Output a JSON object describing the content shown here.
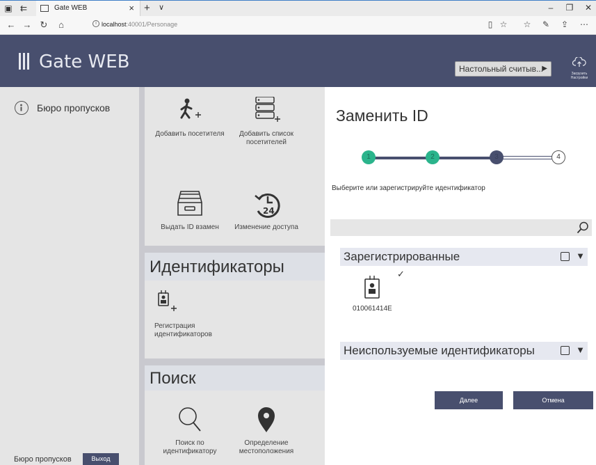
{
  "browser": {
    "tab_title": "Gate WEB",
    "tab_close": "×",
    "new_tab": "+",
    "tab_menu": "∨",
    "url_host": "localhost",
    "url_path": ":40001/Personage",
    "win_minimize": "–",
    "win_maximize": "❐",
    "win_close": "✕"
  },
  "header": {
    "app_title": "Gate WEB",
    "reader_button": "Настольный считыв...",
    "reader_arrow": "▶",
    "cloud_label": "Загрузить Настройки"
  },
  "sidebar": {
    "item_label": "Бюро пропусков",
    "footer_text": "Бюро пропусков",
    "logout_label": "Выход"
  },
  "middle": {
    "tiles_top": [
      {
        "label": "Добавить посетителя"
      },
      {
        "label": "Добавить список посетителей"
      },
      {
        "label": "Выдать ID взамен"
      },
      {
        "label": "Изменение доступа"
      }
    ],
    "section_ids": "Идентификаторы",
    "tile_reg": "Регистрация идентификаторов",
    "section_search": "Поиск",
    "tile_search": "Поиск по идентификатору",
    "tile_location": "Определение местоположения",
    "clock_number": "24"
  },
  "panel": {
    "title": "Заменить ID",
    "steps": [
      "1",
      "2",
      "3",
      "4"
    ],
    "instruction": "Выберите или зарегистрируйте идентификатор",
    "search_value": "",
    "group_registered": "Зарегистрированные",
    "group_unused": "Неиспользуемые идентификаторы",
    "card_id": "010061414E",
    "card_check": "✓",
    "group_arrow": "▼",
    "next_button": "Далее",
    "cancel_button": "Отмена"
  },
  "colors": {
    "header_bg": "#484f6e",
    "step_done": "#2bb48c",
    "step_active": "#484f6e"
  }
}
